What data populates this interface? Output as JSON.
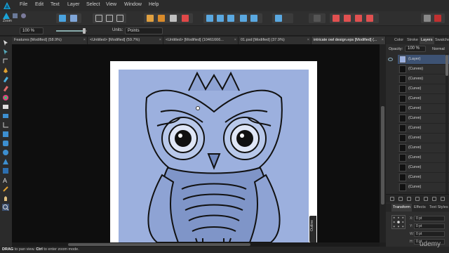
{
  "menubar": {
    "items": [
      "File",
      "Edit",
      "Text",
      "Layer",
      "Select",
      "View",
      "Window",
      "Help"
    ]
  },
  "toolbar": {
    "persona_label": "Zoom"
  },
  "context": {
    "zoom_value": "100 %",
    "units_label": "Units:",
    "units_value": "Points"
  },
  "tabs": [
    {
      "label": "Features [Modified] (58.9%)",
      "active": false
    },
    {
      "label": "<Untitled> [Modified] (59.7%)",
      "active": false
    },
    {
      "label": "<Untitled> [Modified] (10461666...",
      "active": false
    },
    {
      "label": "01.psd [Modified] (37.9%)",
      "active": false
    },
    {
      "label": "intricate owl design.eps [Modified] (...",
      "active": true
    }
  ],
  "canvas": {
    "outline_label": "Outline"
  },
  "panel": {
    "tabs": [
      "Color",
      "Stroke",
      "Layers",
      "Swatches"
    ],
    "active_tab": "Layers",
    "opacity_label": "Opacity:",
    "opacity_value": "100 %",
    "blend_mode": "Normal",
    "layers": [
      "(Layer)",
      "(Curves)",
      "(Curves)",
      "(Curve)",
      "(Curve)",
      "(Curve)",
      "(Curve)",
      "(Curve)",
      "(Curve)",
      "(Curve)",
      "(Curve)",
      "(Curve)",
      "(Curve)",
      "(Curve)"
    ],
    "transform_tabs": [
      "Transform",
      "Effects",
      "Text Styles"
    ],
    "transform_fields": [
      {
        "label": "X:",
        "value": "0 pt"
      },
      {
        "label": "Y:",
        "value": "0 pt"
      },
      {
        "label": "W:",
        "value": "0 pt"
      },
      {
        "label": "H:",
        "value": "0 pt"
      }
    ]
  },
  "status": {
    "key1": "DRAG",
    "text1": " to pan view. ",
    "key2": "Ctrl",
    "text2": " to enter zoom mode."
  },
  "watermark": "udemy",
  "colors": {
    "artwork_background": "#9cb0de",
    "selection": "#3d5273",
    "accent": "#1aa3d6"
  }
}
